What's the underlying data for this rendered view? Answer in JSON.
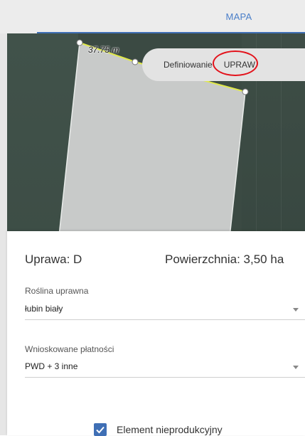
{
  "tabs": {
    "map": "MAPA"
  },
  "map": {
    "dimension_label": "37.75 m",
    "mode_label": "Definiowanie",
    "mode_value": "UPRAW"
  },
  "sheet": {
    "crop_title": "Uprawa: D",
    "area_title": "Powierzchnia: 3,50 ha",
    "plant_label": "Roślina uprawna",
    "plant_value": "łubin biały",
    "payments_label": "Wnioskowane płatności",
    "payments_value": "PWD + 3 inne",
    "nonproductive_label": "Element nieprodukcyjny",
    "nonproductive_checked": true
  },
  "colors": {
    "accent": "#3f6fb5",
    "highlight_ring": "#e3121b",
    "field_polygon": "#c8cac9"
  }
}
